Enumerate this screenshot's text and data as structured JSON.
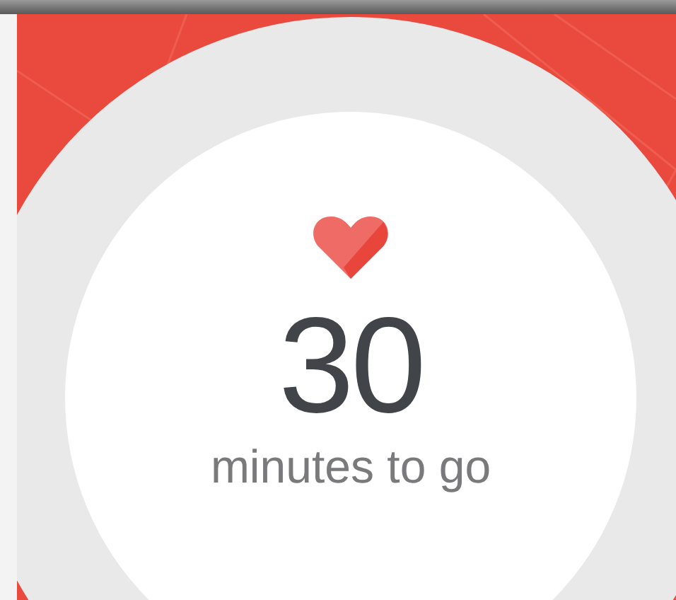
{
  "goal_card": {
    "count": "30",
    "caption": "minutes to go"
  }
}
